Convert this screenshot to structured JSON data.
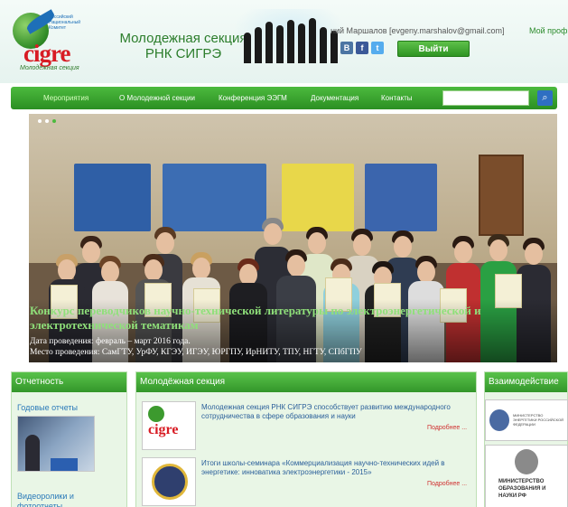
{
  "header": {
    "logo_small_text": "Российский Национальный Комитет",
    "logo_brand": "cigre",
    "logo_sub": "Молодежная секция",
    "site_title": "Молодежная секция РНК СИГРЭ",
    "user_info": "ний Маршалов [evgeny.marshalov@gmail.com]",
    "profile_link": "Мой профи",
    "logout_label": "Выйти",
    "social": [
      "В",
      "f",
      "t"
    ]
  },
  "nav": {
    "items": [
      "Мероприятия",
      "О Молодежной секции",
      "Конференция ЭЭГМ",
      "Документация",
      "Контакты"
    ],
    "active_index": 0,
    "search_placeholder": ""
  },
  "slider": {
    "title": "Конкурс переводчиков научно-технической литературы по электроэнергетической и электротехнической тематикам",
    "date_line": "Дата проведения: февраль – март 2016 года.",
    "place_line": "Место проведения: СамГТУ, УрФУ, КГЭУ, ИГЭУ, ЮРГПУ, ИрНИТУ, ТПУ, НГТУ, СПбГПУ"
  },
  "panels": {
    "reports": {
      "title": "Отчетность",
      "link1": "Годовые отчеты",
      "link2": "Видеоролики и фотоотчеты"
    },
    "youth": {
      "title": "Молодёжная секция",
      "news": [
        {
          "text": "Молодежная секция РНК СИГРЭ способствует развитию международного сотрудничества в сфере образования и науки",
          "more": "Подробнее ..."
        },
        {
          "text": "Итоги школы-семинара «Коммерциализация научно-технических идей в энергетике: инноватика электроэнергетики - 2015»",
          "more": "Подробнее ..."
        }
      ]
    },
    "partners": {
      "title": "Взаимодействие",
      "partner1": "МИНИСТЕРСТВО ЭНЕРГЕТИКИ РОССИЙСКОЙ ФЕДЕРАЦИИ",
      "partner2": "МИНИСТЕРСТВО ОБРАЗОВАНИЯ И НАУКИ РФ"
    }
  },
  "colors": {
    "brand_green": "#2b8f22",
    "brand_red": "#d81c24",
    "link_blue": "#2a5f9a"
  }
}
